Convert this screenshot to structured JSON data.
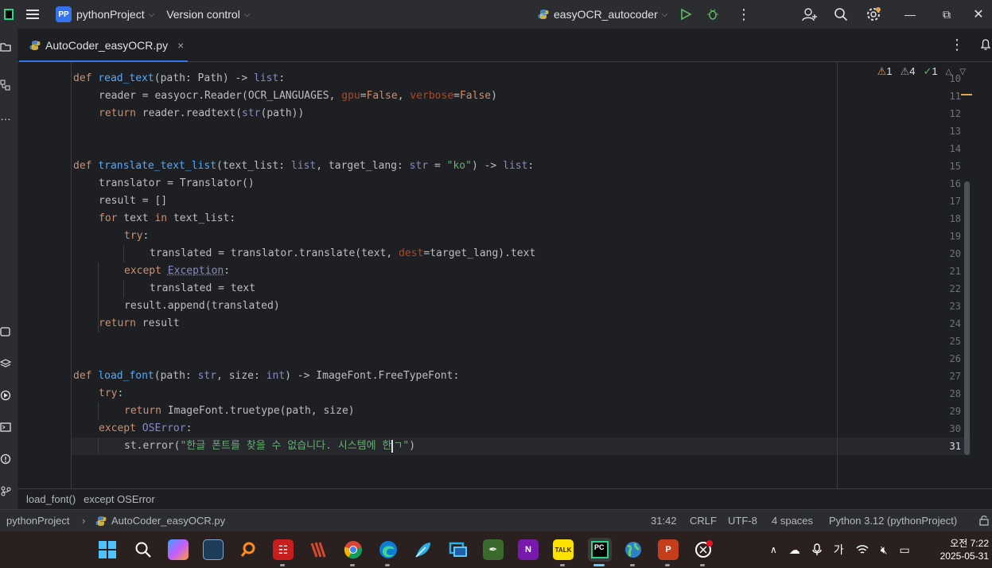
{
  "titlebar": {
    "project_badge": "PP",
    "project_name": "pythonProject",
    "vcs_label": "Version control",
    "run_config": "easyOCR_autocoder"
  },
  "tab": {
    "file_name": "AutoCoder_easyOCR.py",
    "close_glyph": "×"
  },
  "inspections": {
    "errors": "1",
    "warnings": "4",
    "ok": "1"
  },
  "code_lines": [
    {
      "n": "10"
    },
    {
      "n": "11"
    },
    {
      "n": "12"
    },
    {
      "n": "13"
    },
    {
      "n": "14"
    },
    {
      "n": "15"
    },
    {
      "n": "16"
    },
    {
      "n": "17"
    },
    {
      "n": "18"
    },
    {
      "n": "19"
    },
    {
      "n": "20"
    },
    {
      "n": "21"
    },
    {
      "n": "22"
    },
    {
      "n": "23"
    },
    {
      "n": "24"
    },
    {
      "n": "25"
    },
    {
      "n": "26"
    },
    {
      "n": "27"
    },
    {
      "n": "28"
    },
    {
      "n": "29"
    },
    {
      "n": "30"
    },
    {
      "n": "31"
    }
  ],
  "code": {
    "l10": [
      "def",
      " ",
      "read_text",
      "(path: Path) -> ",
      "list",
      ":"
    ],
    "l11": [
      "reader = easyocr.Reader(OCR_LANGUAGES, ",
      "gpu",
      "=",
      "False",
      ", ",
      "verbose",
      "=",
      "False",
      ")"
    ],
    "l12": [
      "return",
      " reader.readtext(",
      "str",
      "(path))"
    ],
    "l15": [
      "def",
      " ",
      "translate_text_list",
      "(text_list: ",
      "list",
      ", target_lang: ",
      "str",
      " = ",
      "\"ko\"",
      ") -> ",
      "list",
      ":"
    ],
    "l16": [
      "translator = Translator()"
    ],
    "l17": [
      "result = []"
    ],
    "l18": [
      "for",
      " text ",
      "in",
      " text_list:"
    ],
    "l19": [
      "try",
      ":"
    ],
    "l20": [
      "translated = translator.translate(text, ",
      "dest",
      "=target_lang).text"
    ],
    "l21": [
      "except",
      " ",
      "Exception",
      ":"
    ],
    "l22": [
      "translated = text"
    ],
    "l23": [
      "result.append(translated)"
    ],
    "l24": [
      "return",
      " result"
    ],
    "l27": [
      "def",
      " ",
      "load_font",
      "(path: ",
      "str",
      ", size: ",
      "int",
      ") -> ImageFont.FreeTypeFont:"
    ],
    "l28": [
      "try",
      ":"
    ],
    "l29": [
      "return",
      " ImageFont.truetype(path, size)"
    ],
    "l30": [
      "except",
      " ",
      "OSError",
      ":"
    ],
    "l31": [
      "st.error(",
      "\"한글 폰트를 찾을 수 없습니다. 시스템에 한",
      "ㄱ",
      "\"",
      ")"
    ]
  },
  "breadcrumb": {
    "item1": "load_font()",
    "item2": "except OSError"
  },
  "statusbar": {
    "project": "pythonProject",
    "file": "AutoCoder_easyOCR.py",
    "position": "31:42",
    "line_sep": "CRLF",
    "encoding": "UTF-8",
    "indent": "4 spaces",
    "interpreter": "Python 3.12 (pythonProject)"
  },
  "taskbar": {
    "ime_label": "가",
    "clock_time": "오전 7:22",
    "clock_date": "2025-05-31",
    "pycharm_label": "PC",
    "onenote_label": "N",
    "kakao_label": "TALK",
    "ppt_label": "P"
  },
  "colors": {
    "accent": "#3574f0",
    "keyword": "#cf8e6d",
    "function": "#56a8f5",
    "string": "#6aab73",
    "builtin": "#8888c6",
    "param": "#aa4926"
  }
}
